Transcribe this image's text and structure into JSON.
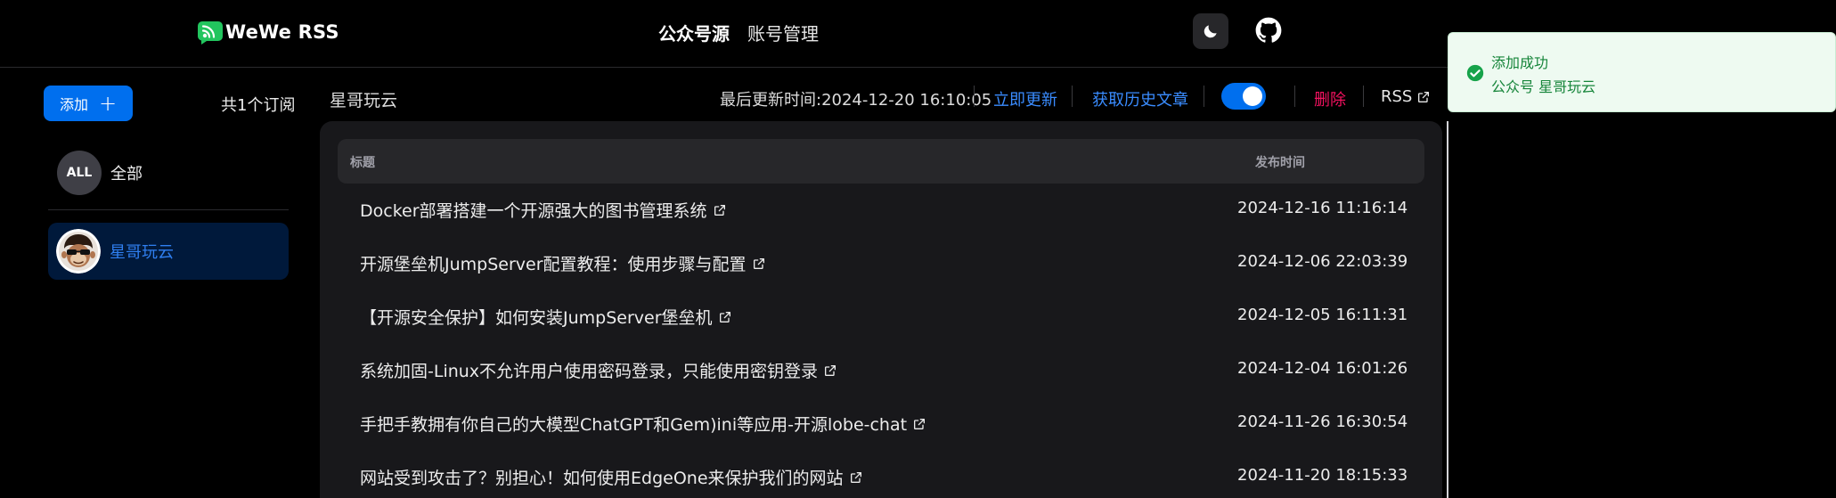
{
  "header": {
    "brand": "WeWe RSS",
    "nav": [
      {
        "label": "公众号源",
        "active": true
      },
      {
        "label": "账号管理",
        "active": false
      }
    ],
    "icons": [
      "rss-logo-icon",
      "moon-icon",
      "github-icon"
    ]
  },
  "sidebar": {
    "add_label": "添加",
    "count_label": "共1个订阅",
    "all_avatar": "ALL",
    "all_label": "全部",
    "feeds": [
      {
        "name": "星哥玩云",
        "selected": true
      }
    ]
  },
  "main": {
    "feed_title": "星哥玩云",
    "update_time": "最后更新时间:2024-12-20 16:10:05",
    "refresh_label": "立即更新",
    "history_label": "获取历史文章",
    "toggle_on": true,
    "delete_label": "删除",
    "rss_label": "RSS",
    "columns": {
      "title": "标题",
      "date": "发布时间"
    },
    "rows": [
      {
        "title": "Docker部署搭建一个开源强大的图书管理系统",
        "date": "2024-12-16 11:16:14"
      },
      {
        "title": "开源堡垒机JumpServer配置教程：使用步骤与配置",
        "date": "2024-12-06 22:03:39"
      },
      {
        "title": "【开源安全保护】如何安装JumpServer堡垒机",
        "date": "2024-12-05 16:11:31"
      },
      {
        "title": "系统加固-Linux不允许用户使用密码登录，只能使用密钥登录",
        "date": "2024-12-04 16:01:26"
      },
      {
        "title": "手把手教拥有你自己的大模型ChatGPT和Gem)ini等应用-开源lobe-chat",
        "date": "2024-11-26 16:30:54"
      },
      {
        "title": "网站受到攻击了？别担心！如何使用EdgeOne来保护我们的网站",
        "date": "2024-11-20 18:15:33"
      }
    ]
  },
  "toast": {
    "title": "添加成功",
    "message": "公众号 星哥玩云"
  },
  "colors": {
    "accent": "#006fee",
    "danger": "#f31260",
    "success": "#16853a",
    "background": "#000000"
  }
}
